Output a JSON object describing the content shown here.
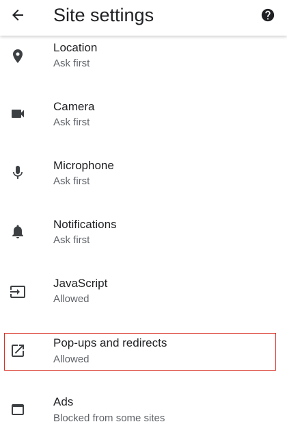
{
  "app_bar": {
    "title": "Site settings",
    "back_icon": "arrow-back-icon",
    "help_icon": "help-circle-icon"
  },
  "settings": [
    {
      "title": "Location",
      "subtitle": "Ask first",
      "icon": "location-pin-icon"
    },
    {
      "title": "Camera",
      "subtitle": "Ask first",
      "icon": "video-camera-icon"
    },
    {
      "title": "Microphone",
      "subtitle": "Ask first",
      "icon": "microphone-icon"
    },
    {
      "title": "Notifications",
      "subtitle": "Ask first",
      "icon": "bell-icon"
    },
    {
      "title": "JavaScript",
      "subtitle": "Allowed",
      "icon": "input-arrow-icon"
    },
    {
      "title": "Pop-ups and redirects",
      "subtitle": "Allowed",
      "icon": "open-in-new-icon",
      "highlighted": true
    },
    {
      "title": "Ads",
      "subtitle": "Blocked from some sites",
      "icon": "browser-window-icon"
    }
  ],
  "colors": {
    "text_primary": "#202124",
    "text_secondary": "#5f6368",
    "icon": "#3c4043",
    "highlight": "#d93025"
  }
}
